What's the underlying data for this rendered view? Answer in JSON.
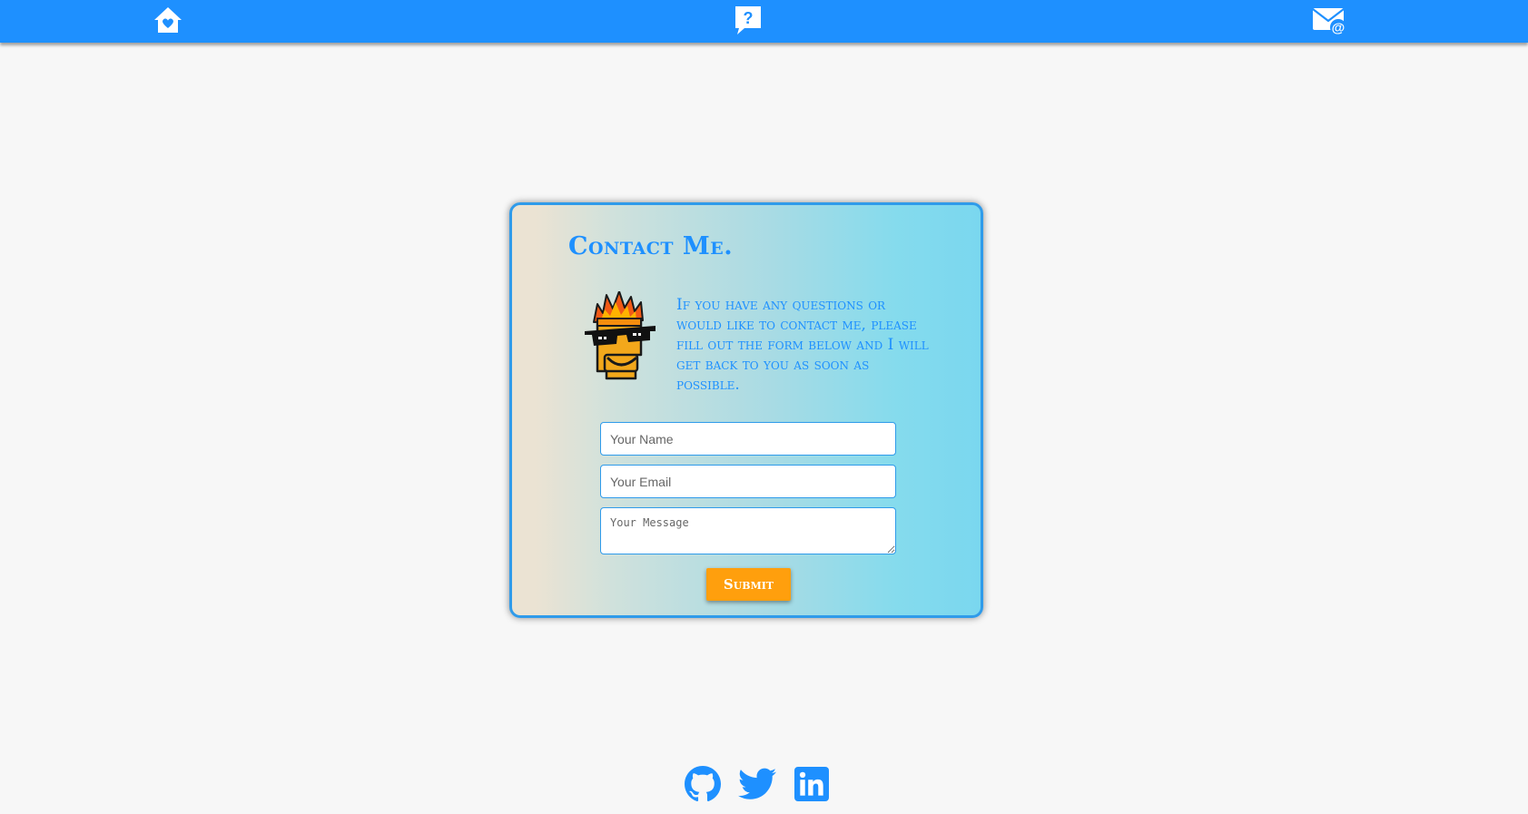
{
  "navbar": {
    "items": [
      {
        "name": "home",
        "icon": "home-heart-icon"
      },
      {
        "name": "about",
        "icon": "question-bubble-icon"
      },
      {
        "name": "contact",
        "icon": "mail-at-icon"
      }
    ],
    "background": "#1e90ff"
  },
  "contact": {
    "title": "Contact Me.",
    "intro": "If you have any questions or would like to contact me, please fill out the form below and I will get back to you as soon as possible.",
    "mascot_icon": "fire-hair-sunglasses-mascot-icon",
    "form": {
      "name_placeholder": "Your Name",
      "email_placeholder": "Your Email",
      "message_placeholder": "Your Message",
      "submit_label": "Submit"
    }
  },
  "social": [
    {
      "name": "github",
      "icon": "github-icon"
    },
    {
      "name": "twitter",
      "icon": "twitter-icon"
    },
    {
      "name": "linkedin",
      "icon": "linkedin-icon"
    }
  ],
  "colors": {
    "accent": "#1e90ff",
    "button": "#ff9f0d",
    "background": "#f7f7f7",
    "card_border": "#2f9bea"
  }
}
